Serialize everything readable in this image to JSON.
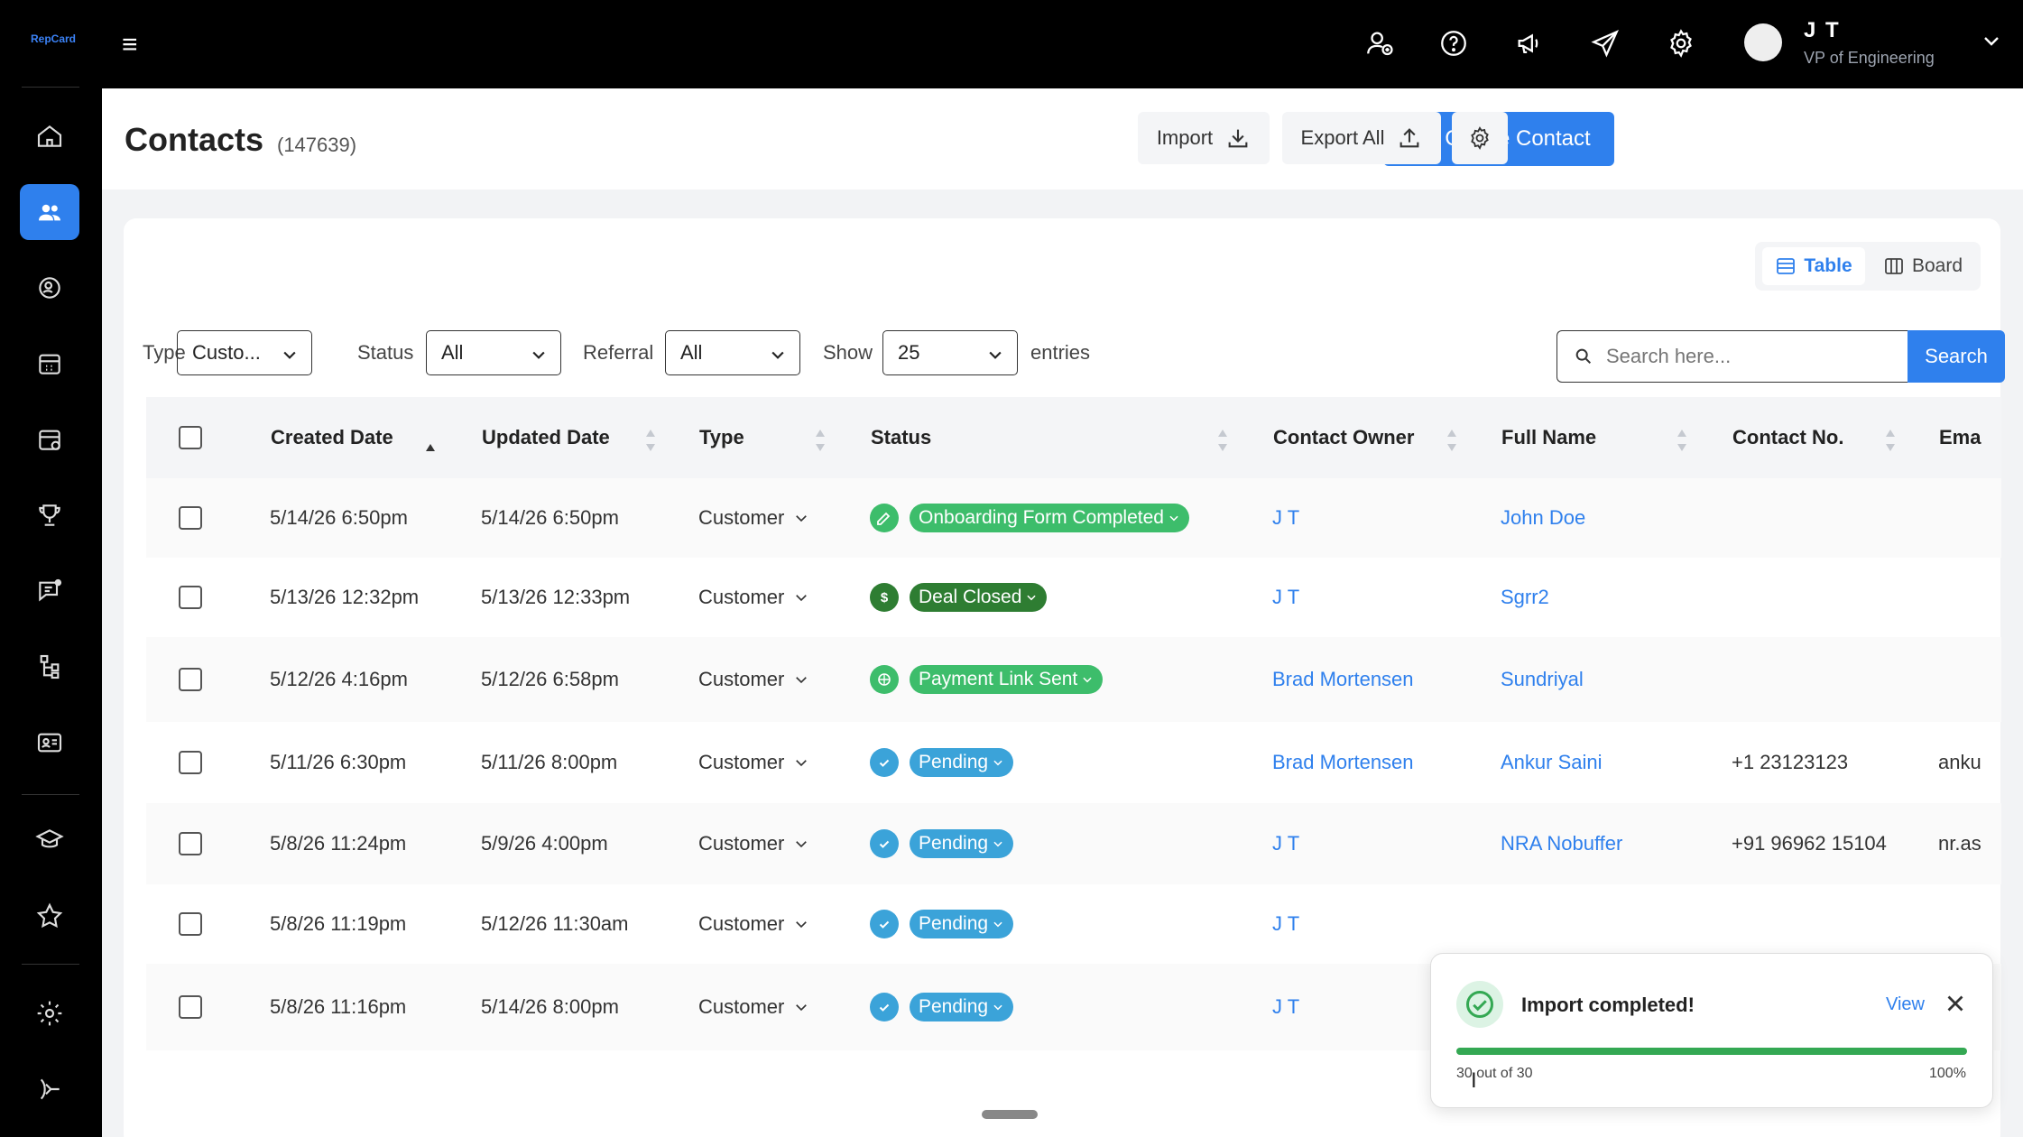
{
  "app": {
    "logo_text": "RepCard"
  },
  "topbar": {
    "user_name": "J T",
    "user_role": "VP of Engineering"
  },
  "header": {
    "title": "Contacts",
    "count": "(147639)",
    "create_label": "Create Contact",
    "import_label": "Import",
    "export_label": "Export All"
  },
  "view": {
    "table_label": "Table",
    "board_label": "Board"
  },
  "filters": {
    "type_label": "Type",
    "type_value": "Custo...",
    "status_label": "Status",
    "status_value": "All",
    "referral_label": "Referral",
    "referral_value": "All",
    "show_label": "Show",
    "show_value": "25",
    "entries_label": "entries"
  },
  "search": {
    "placeholder": "Search here...",
    "button_label": "Search"
  },
  "table": {
    "columns": [
      "Created Date",
      "Updated Date",
      "Type",
      "Status",
      "Contact Owner",
      "Full Name",
      "Contact No.",
      "Ema"
    ],
    "rows": [
      {
        "created": "5/14/26 6:50pm",
        "updated": "5/14/26 6:50pm",
        "type": "Customer",
        "status": "Onboarding Form Completed",
        "status_color": "#3dbd6b",
        "status_icon": "pencil-icon",
        "owner": "J T",
        "name": "John Doe",
        "phone": "",
        "email": ""
      },
      {
        "created": "5/13/26 12:32pm",
        "updated": "5/13/26 12:33pm",
        "type": "Customer",
        "status": "Deal Closed",
        "status_color": "#2e7d32",
        "status_icon": "dollar-icon",
        "owner": "J T",
        "name": "Sgrr2",
        "phone": "",
        "email": ""
      },
      {
        "created": "5/12/26 4:16pm",
        "updated": "5/12/26 6:58pm",
        "type": "Customer",
        "status": "Payment Link Sent",
        "status_color": "#3dbd6b",
        "status_icon": "globe-icon",
        "owner": "Brad Mortensen",
        "name": "Sundriyal",
        "phone": "",
        "email": ""
      },
      {
        "created": "5/11/26 6:30pm",
        "updated": "5/11/26 8:00pm",
        "type": "Customer",
        "status": "Pending",
        "status_color": "#3ba3d9",
        "status_icon": "check-icon",
        "owner": "Brad Mortensen",
        "name": "Ankur Saini",
        "phone": "+1 23123123",
        "email": "anku"
      },
      {
        "created": "5/8/26 11:24pm",
        "updated": "5/9/26 4:00pm",
        "type": "Customer",
        "status": "Pending",
        "status_color": "#3ba3d9",
        "status_icon": "check-icon",
        "owner": "J T",
        "name": "NRA Nobuffer",
        "phone": "+91 96962 15104",
        "email": "nr.as"
      },
      {
        "created": "5/8/26 11:19pm",
        "updated": "5/12/26 11:30am",
        "type": "Customer",
        "status": "Pending",
        "status_color": "#3ba3d9",
        "status_icon": "check-icon",
        "owner": "J T",
        "name": "",
        "phone": "",
        "email": ""
      },
      {
        "created": "5/8/26 11:16pm",
        "updated": "5/14/26 8:00pm",
        "type": "Customer",
        "status": "Pending",
        "status_color": "#3ba3d9",
        "status_icon": "check-icon",
        "owner": "J T",
        "name": "",
        "phone": "",
        "email": ""
      }
    ]
  },
  "toast": {
    "title": "Import completed!",
    "view_label": "View",
    "count_text": "30 out of 30",
    "percent_text": "100%",
    "progress": 1.0
  },
  "colors": {
    "accent": "#2f80ed",
    "success": "#34a853"
  }
}
